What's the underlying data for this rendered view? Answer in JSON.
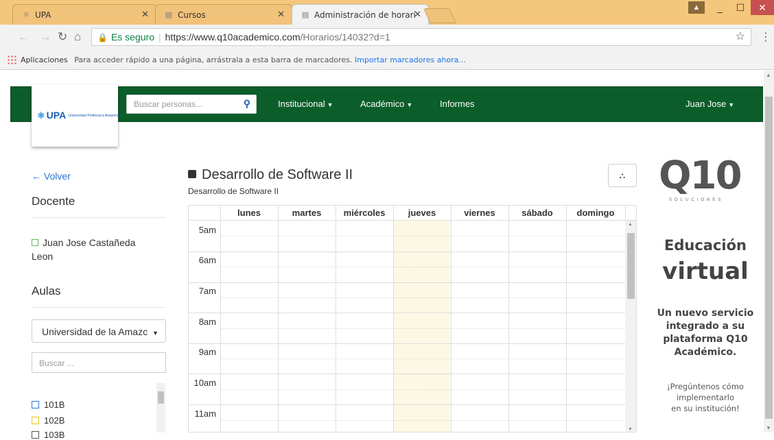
{
  "browser": {
    "tabs": [
      {
        "label": "UPA",
        "icon": "atom-icon"
      },
      {
        "label": "Cursos",
        "icon": "page-icon"
      },
      {
        "label": "Administración de horari",
        "icon": "page-icon"
      }
    ],
    "address": {
      "secure_label": "Es seguro",
      "url_base": "https://www.q10academico.com",
      "url_path": "/Horarios/14032?d=1"
    },
    "bookmarks": {
      "apps_label": "Aplicaciones",
      "hint": "Para acceder rápido a una página, arrástrala a esta barra de marcadores.",
      "import_link": "Importar marcadores ahora..."
    }
  },
  "navbar": {
    "logo_text": "UPA",
    "logo_sub": "Universidad Politécnica Amazónica",
    "search_placeholder": "Buscar personas...",
    "menu": [
      {
        "label": "Institucional",
        "dropdown": true
      },
      {
        "label": "Académico",
        "dropdown": true
      },
      {
        "label": "Informes",
        "dropdown": false
      }
    ],
    "user": "Juan Jose"
  },
  "sidebar": {
    "back_label": "Volver",
    "docente_heading": "Docente",
    "teacher_line1": "Juan Jose Castañeda",
    "teacher_line2": "Leon",
    "aulas_heading": "Aulas",
    "campus_select": "Universidad de la Amazc",
    "room_search_placeholder": "Buscar ...",
    "rooms": [
      {
        "label": "101B",
        "color": "#2a72d4"
      },
      {
        "label": "102B",
        "color": "#f0c419"
      },
      {
        "label": "103B",
        "color": "#555555"
      }
    ]
  },
  "main": {
    "title": "Desarrollo de Software II",
    "subtitle": "Desarrollo de Software II"
  },
  "calendar": {
    "days": [
      "lunes",
      "martes",
      "miércoles",
      "jueves",
      "viernes",
      "sábado",
      "domingo"
    ],
    "highlight_day": "jueves",
    "hours": [
      "5am",
      "6am",
      "7am",
      "8am",
      "9am",
      "10am",
      "11am"
    ]
  },
  "ad": {
    "logo": "Q10",
    "logo_sub": "SOLUCIONES",
    "headline1": "Educación",
    "headline2": "virtual",
    "desc_line1": "Un nuevo servicio",
    "desc_line2": "integrado a su",
    "desc_line3": "plataforma Q10",
    "desc_line4": "Académico.",
    "ask_line1": "¡Pregúntenos cómo",
    "ask_line2": "implementarlo",
    "ask_line3": "en su institución!"
  },
  "colors": {
    "navbar": "#0b5d2a",
    "link": "#2a72d4",
    "today_highlight": "#fcf8e3"
  }
}
